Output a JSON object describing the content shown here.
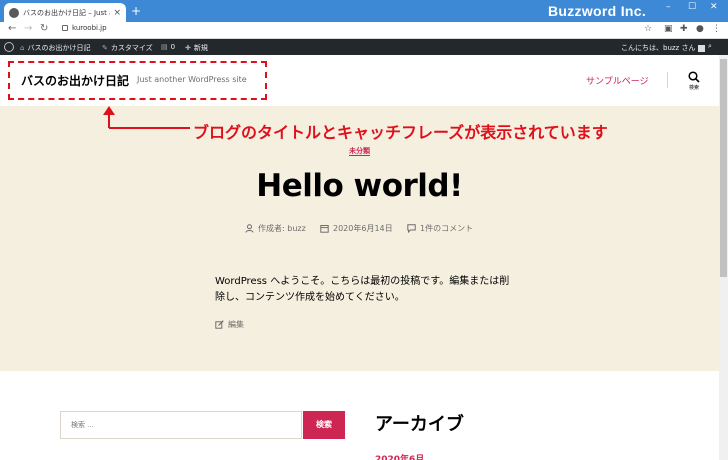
{
  "browser": {
    "tab_title": "バスのお出かけ日記 – Just another",
    "tab_close": "×",
    "new_tab": "+",
    "brand": "Buzzword Inc.",
    "url": "kuroobi.jp",
    "controls": {
      "minimize": "–",
      "maximize": "☐",
      "close": "✕"
    }
  },
  "adminbar": {
    "site_name": "バスのお出かけ日記",
    "customize": "カスタマイズ",
    "comments_count": "0",
    "new": "新規",
    "greeting": "こんにちは、buzz さん"
  },
  "header": {
    "site_title": "バスのお出かけ日記",
    "tagline": "Just another WordPress site",
    "menu_item": "サンプルページ",
    "search_label": "検索"
  },
  "annotation": {
    "text": "ブログのタイトルとキャッチフレーズが表示されています",
    "color": "#e0101a"
  },
  "post": {
    "category": "未分類",
    "title": "Hello world!",
    "author": "作成者: buzz",
    "date": "2020年6月14日",
    "comments": "1件のコメント",
    "body": "WordPress へようこそ。こちらは最初の投稿です。編集または削除し、コンテンツ作成を始めてください。",
    "edit": "編集"
  },
  "widgets": {
    "search_placeholder": "検索 …",
    "search_button": "検索",
    "archive_title": "アーカイブ",
    "archive_item": "2020年6月"
  },
  "colors": {
    "accent": "#cd2653",
    "hero_bg": "#f5efe0",
    "browser_bar": "#3d89d6",
    "admin_bar": "#23282d"
  }
}
